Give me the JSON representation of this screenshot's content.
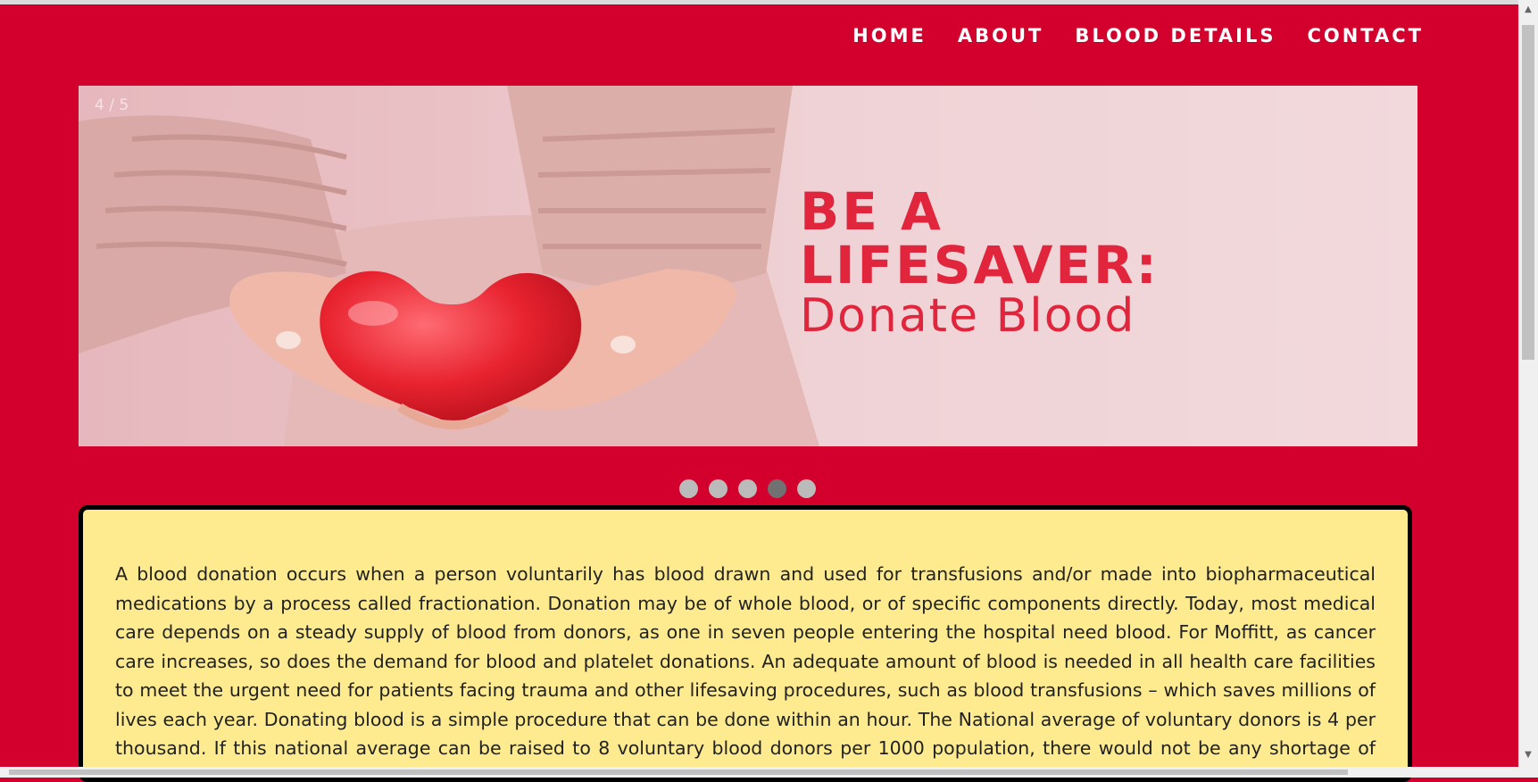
{
  "nav": {
    "items": [
      {
        "label": "HOME"
      },
      {
        "label": "ABOUT"
      },
      {
        "label": "BLOOD DETAILS"
      },
      {
        "label": "CONTACT"
      }
    ]
  },
  "slider": {
    "counter": "4 / 5",
    "title_line1": "BE A",
    "title_line2": "LIFESAVER:",
    "title_line3": "Donate Blood",
    "total_slides": 5,
    "active_slide": 4
  },
  "info": {
    "text": "A blood donation occurs when a person voluntarily has blood drawn and used for transfusions and/or made into biopharmaceutical medications by a process called fractionation. Donation may be of whole blood, or of specific components directly. Today, most medical care depends on a steady supply of blood from donors, as one in seven people entering the hospital need blood. For Moffitt, as cancer care increases, so does the demand for blood and platelet donations. An adequate amount of blood is needed in all health care facilities to meet the urgent need for patients facing trauma and other lifesaving procedures, such as blood transfusions – which saves millions of lives each year. Donating blood is a simple procedure that can be done within an hour. The National average of voluntary donors is 4 per thousand. If this national average can be raised to 8 voluntary blood donors per 1000 population, there would not be any shortage of blood for the country and we would dispose out of blood for"
  },
  "colors": {
    "background": "#d3002d",
    "panel": "#feea8f",
    "accent_text": "#e0253c"
  }
}
